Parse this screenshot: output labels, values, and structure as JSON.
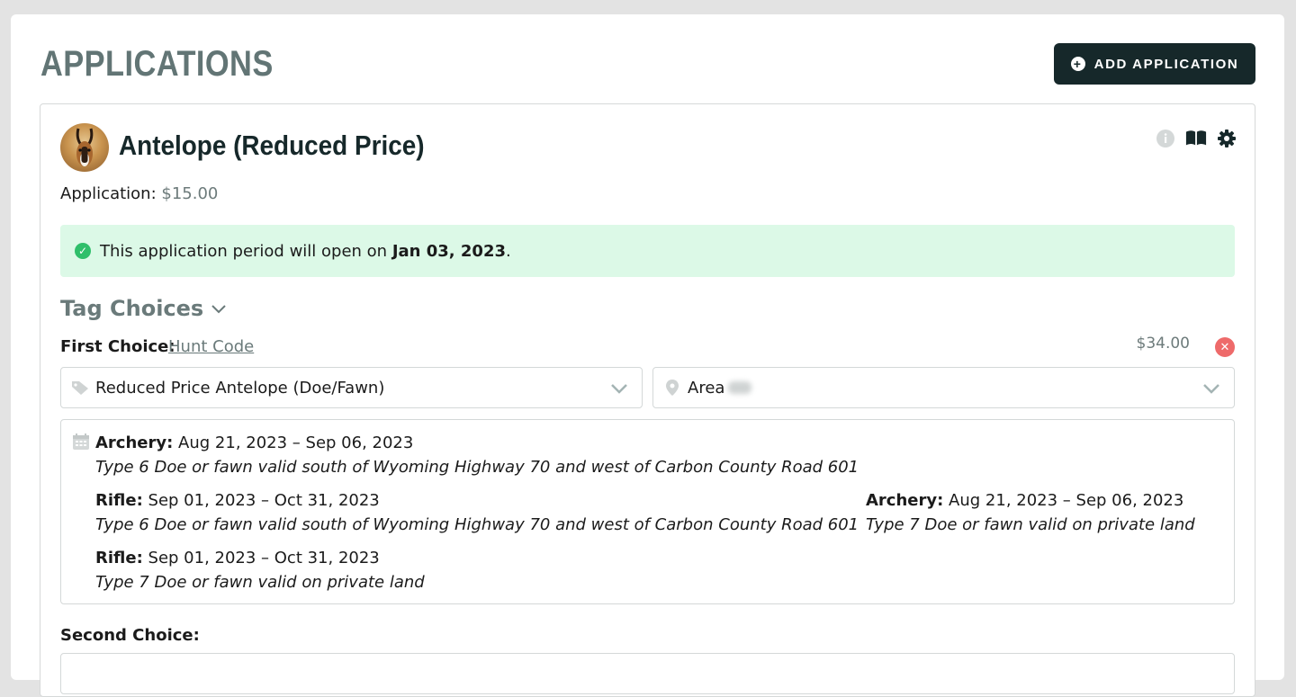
{
  "page": {
    "title": "APPLICATIONS",
    "add_button_label": "ADD APPLICATION"
  },
  "application": {
    "species": "Antelope (Reduced Price)",
    "fee_label": "Application:",
    "fee_amount": "$15.00",
    "notice_text": "This application period will open on ",
    "notice_date": "Jan 03, 2023",
    "notice_suffix": ".",
    "section_title": "Tag Choices",
    "icons": [
      "info-icon",
      "book-icon",
      "gear-icon"
    ],
    "accent_color": "#16282a",
    "notice_color": "#dcf9e7"
  },
  "first_choice": {
    "label": "First Choice:",
    "hunt_code_link": "Hunt Code",
    "price": "$34.00",
    "license_select": "Reduced Price Antelope (Doe/Fawn)",
    "area_select": "Area",
    "seasons": [
      {
        "name": "Archery:",
        "dates": "Aug 21, 2023 – Sep 06, 2023",
        "desc": "Type 6 Doe or fawn valid south of Wyoming Highway 70 and west of Carbon County Road 601"
      },
      {
        "name": "Rifle:",
        "dates": "Sep 01, 2023 – Oct 31, 2023",
        "desc": "Type 6 Doe or fawn valid south of Wyoming Highway 70 and west of Carbon County Road 601"
      },
      {
        "name": "Archery:",
        "dates": "Aug 21, 2023 – Sep 06, 2023",
        "desc": "Type 7 Doe or fawn valid on private land"
      },
      {
        "name": "Rifle:",
        "dates": "Sep 01, 2023 – Oct 31, 2023",
        "desc": "Type 7 Doe or fawn valid on private land"
      }
    ]
  },
  "second_choice": {
    "label": "Second Choice:"
  }
}
